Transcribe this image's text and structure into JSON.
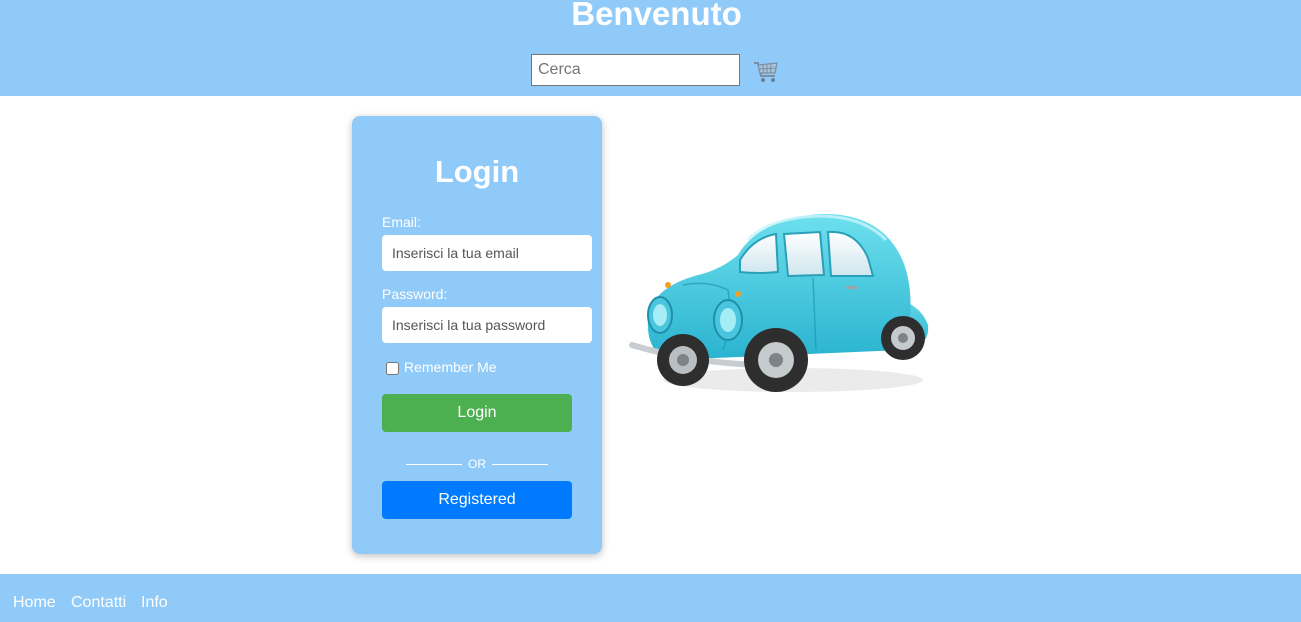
{
  "header": {
    "title": "Benvenuto",
    "search_placeholder": "Cerca",
    "cart_icon": "shopping-cart-icon"
  },
  "login": {
    "title": "Login",
    "email_label": "Email:",
    "email_placeholder": "Inserisci la tua email",
    "password_label": "Password:",
    "password_placeholder": "Inserisci la tua password",
    "remember_label": "Remember Me",
    "remember_checked": false,
    "login_button": "Login",
    "or_text": "OR",
    "register_button": "Registered"
  },
  "hero_image": "blue-beetle-car-illustration",
  "footer": {
    "links": [
      "Home",
      "Contatti",
      "Info"
    ]
  },
  "colors": {
    "primary_bg": "#90caf9",
    "login_button": "#4caf50",
    "register_button": "#007bff"
  }
}
